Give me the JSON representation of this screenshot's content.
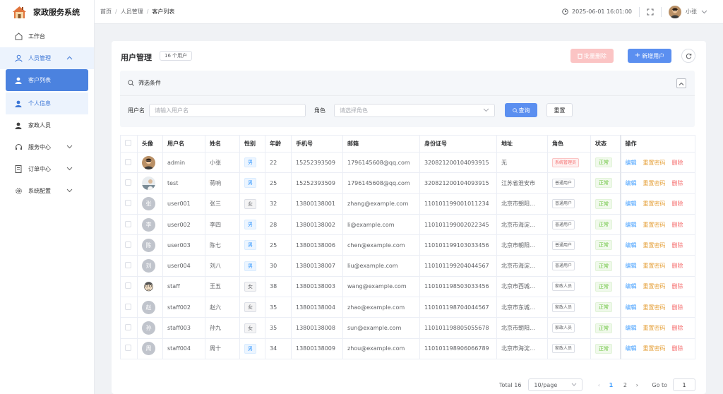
{
  "app": {
    "title": "家政服务系统"
  },
  "sidebar": {
    "items": [
      {
        "label": "工作台",
        "icon": "home-icon"
      },
      {
        "label": "人员管理",
        "icon": "user-icon"
      },
      {
        "label": "客户列表",
        "icon": "user-solid-icon"
      },
      {
        "label": "个人信息",
        "icon": "user-solid-icon"
      },
      {
        "label": "家政人员",
        "icon": "user-solid-icon"
      },
      {
        "label": "服务中心",
        "icon": "headset-icon"
      },
      {
        "label": "订单中心",
        "icon": "document-icon"
      },
      {
        "label": "系统配置",
        "icon": "gear-icon"
      }
    ]
  },
  "header": {
    "breadcrumb": [
      "首页",
      "人员管理",
      "客户列表"
    ],
    "datetime": "2025-06-01 16:01:00",
    "username": "小张"
  },
  "page": {
    "title": "用户管理",
    "count": "16 个用户",
    "batch_delete": "批量删除",
    "add_user": "新增用户"
  },
  "filter": {
    "title": "筛选条件",
    "username_label": "用户名",
    "username_placeholder": "请输入用户名",
    "role_label": "角色",
    "role_placeholder": "请选择角色",
    "query": "查询",
    "reset": "重置"
  },
  "table": {
    "columns": [
      "头像",
      "用户名",
      "姓名",
      "性别",
      "年龄",
      "手机号",
      "邮箱",
      "身份证号",
      "地址",
      "角色",
      "状态",
      "操作"
    ],
    "actions": {
      "edit": "编辑",
      "reset_pwd": "重置密码",
      "delete": "删除"
    },
    "rows": [
      {
        "avatar": "photo",
        "username": "admin",
        "name": "小张",
        "gender": "男",
        "age": "22",
        "phone": "15252393509",
        "email": "1796145608@qq.com",
        "id_no": "320821200104093915",
        "address": "无",
        "role": "系统管理员",
        "role_type": "admin",
        "status": "正常"
      },
      {
        "avatar": "photo2",
        "username": "test",
        "name": "蒋响",
        "gender": "男",
        "age": "25",
        "phone": "15252393509",
        "email": "1796145608@qq.com",
        "id_no": "320821200104093915",
        "address": "江苏省淮安市",
        "role": "普通用户",
        "role_type": "normal",
        "status": "正常"
      },
      {
        "avatar": "张",
        "username": "user001",
        "name": "张三",
        "gender": "女",
        "age": "32",
        "phone": "13800138001",
        "email": "zhang@example.com",
        "id_no": "110101199001011234",
        "address": "北京市朝阳...",
        "role": "普通用户",
        "role_type": "normal",
        "status": "正常"
      },
      {
        "avatar": "李",
        "username": "user002",
        "name": "李四",
        "gender": "男",
        "age": "28",
        "phone": "13800138002",
        "email": "li@example.com",
        "id_no": "110101199002022345",
        "address": "北京市海淀...",
        "role": "普通用户",
        "role_type": "normal",
        "status": "正常"
      },
      {
        "avatar": "陈",
        "username": "user003",
        "name": "陈七",
        "gender": "男",
        "age": "25",
        "phone": "13800138006",
        "email": "chen@example.com",
        "id_no": "110101199103033456",
        "address": "北京市朝阳...",
        "role": "普通用户",
        "role_type": "normal",
        "status": "正常"
      },
      {
        "avatar": "刘",
        "username": "user004",
        "name": "刘八",
        "gender": "男",
        "age": "30",
        "phone": "13800138007",
        "email": "liu@example.com",
        "id_no": "110101199204044567",
        "address": "北京市海淀...",
        "role": "普通用户",
        "role_type": "normal",
        "status": "正常"
      },
      {
        "avatar": "cartoon",
        "username": "staff",
        "name": "王五",
        "gender": "女",
        "age": "38",
        "phone": "13800138003",
        "email": "wang@example.com",
        "id_no": "110101198503033456",
        "address": "北京市西城...",
        "role": "家政人员",
        "role_type": "staff",
        "status": "正常"
      },
      {
        "avatar": "赵",
        "username": "staff002",
        "name": "赵六",
        "gender": "女",
        "age": "35",
        "phone": "13800138004",
        "email": "zhao@example.com",
        "id_no": "110101198704044567",
        "address": "北京市东城...",
        "role": "家政人员",
        "role_type": "staff",
        "status": "正常"
      },
      {
        "avatar": "孙",
        "username": "staff003",
        "name": "孙九",
        "gender": "女",
        "age": "35",
        "phone": "13800138008",
        "email": "sun@example.com",
        "id_no": "110101198805055678",
        "address": "北京市朝阳...",
        "role": "家政人员",
        "role_type": "staff",
        "status": "正常"
      },
      {
        "avatar": "周",
        "username": "staff004",
        "name": "周十",
        "gender": "男",
        "age": "34",
        "phone": "13800138009",
        "email": "zhou@example.com",
        "id_no": "110101198906066789",
        "address": "北京市海淀...",
        "role": "家政人员",
        "role_type": "staff",
        "status": "正常"
      }
    ]
  },
  "pagination": {
    "total": "Total 16",
    "page_size": "10/page",
    "pages": [
      "1",
      "2"
    ],
    "goto_label": "Go to",
    "goto_value": "1"
  },
  "colors": {
    "primary": "#4b82df",
    "danger": "#f56c6c",
    "warning": "#e6a23c",
    "success": "#67c23a"
  }
}
